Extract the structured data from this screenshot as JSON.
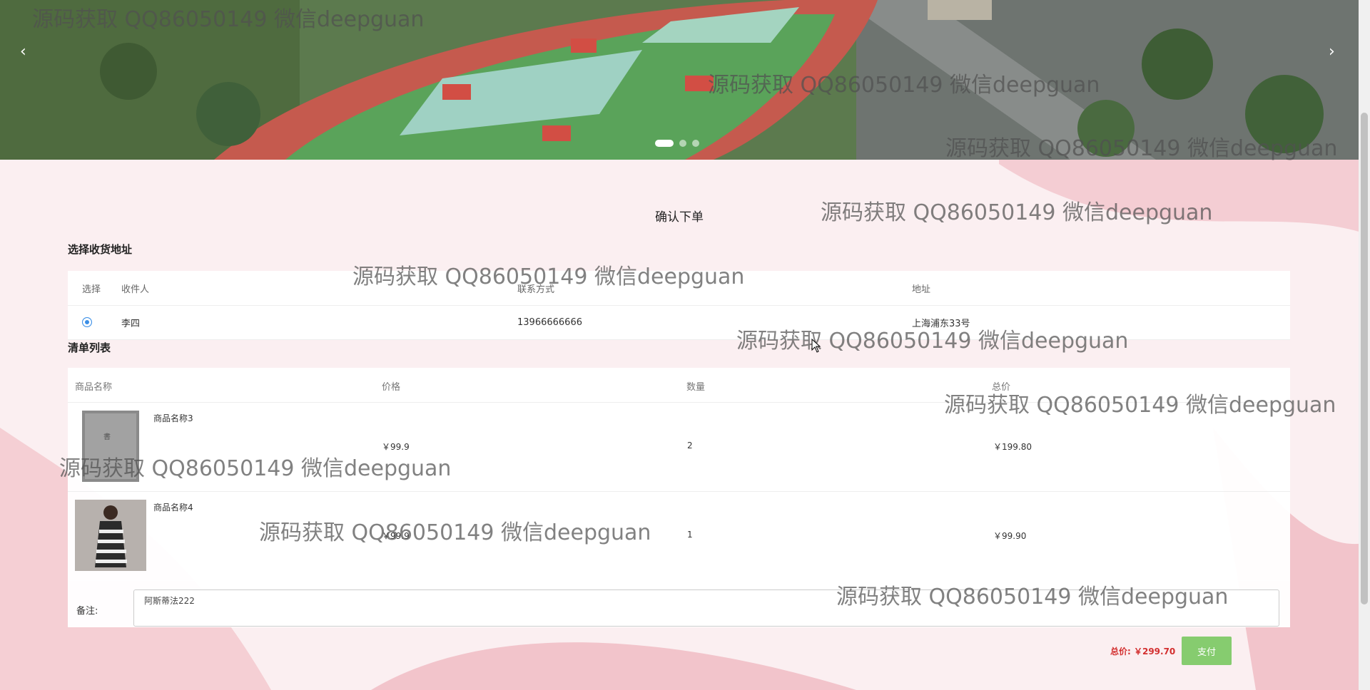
{
  "carousel": {
    "prev": "‹",
    "next": "›",
    "slides": 3,
    "active": 1
  },
  "page_title": "确认下单",
  "address_section": {
    "title": "选择收货地址",
    "headers": {
      "select": "选择",
      "recipient": "收件人",
      "contact": "联系方式",
      "address": "地址"
    },
    "rows": [
      {
        "recipient": "李四",
        "contact": "13966666666",
        "address": "上海浦东33号",
        "selected": true
      }
    ]
  },
  "list_section": {
    "title": "清单列表",
    "headers": {
      "name": "商品名称",
      "price": "价格",
      "qty": "数量",
      "total": "总价"
    },
    "items": [
      {
        "name": "商品名称3",
        "price": "￥99.9",
        "qty": "2",
        "total": "￥199.80"
      },
      {
        "name": "商品名称4",
        "price": "￥99.9",
        "qty": "1",
        "total": "￥99.90"
      }
    ]
  },
  "remark": {
    "label": "备注:",
    "value": "阿斯蒂法222"
  },
  "summary": {
    "total": "总价: ￥299.70",
    "pay_label": "支付"
  },
  "watermark_text": "源码获取 QQ86050149 微信deepguan",
  "colors": {
    "accent": "#3a8ee6",
    "pay": "#86cc6f",
    "price": "#d32f2f",
    "bg": "#f7dfe2"
  }
}
